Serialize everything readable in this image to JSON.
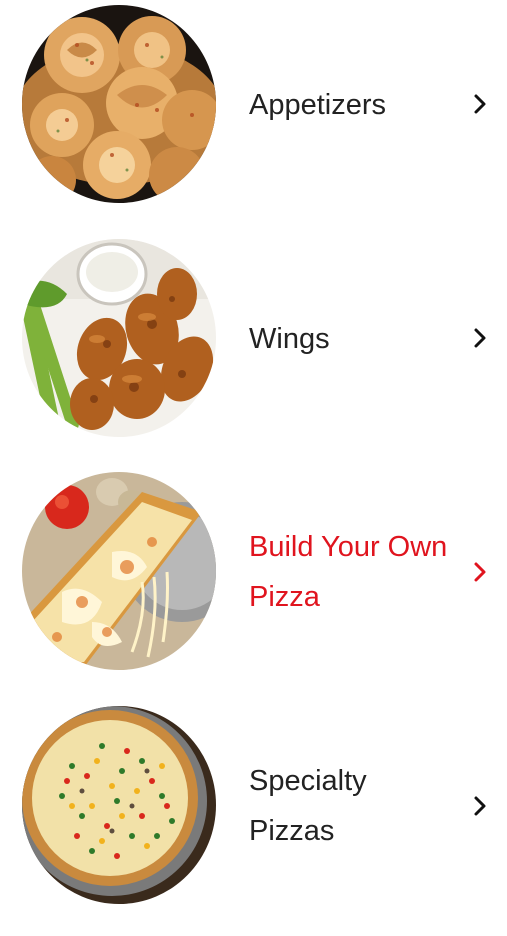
{
  "menu": {
    "accent_color": "#e0141e",
    "chevron_icon": "chevron-right-icon",
    "items": [
      {
        "id": "appetizers",
        "label": "Appetizers",
        "image": "garlic-knots-image",
        "active": false
      },
      {
        "id": "wings",
        "label": "Wings",
        "image": "chicken-wings-image",
        "active": false
      },
      {
        "id": "build-your-own-pizza",
        "label": "Build Your Own\nPizza",
        "image": "cheese-pizza-slice-image",
        "active": true
      },
      {
        "id": "specialty-pizzas",
        "label": "Specialty\nPizzas",
        "image": "veggie-pizza-image",
        "active": false
      }
    ]
  }
}
